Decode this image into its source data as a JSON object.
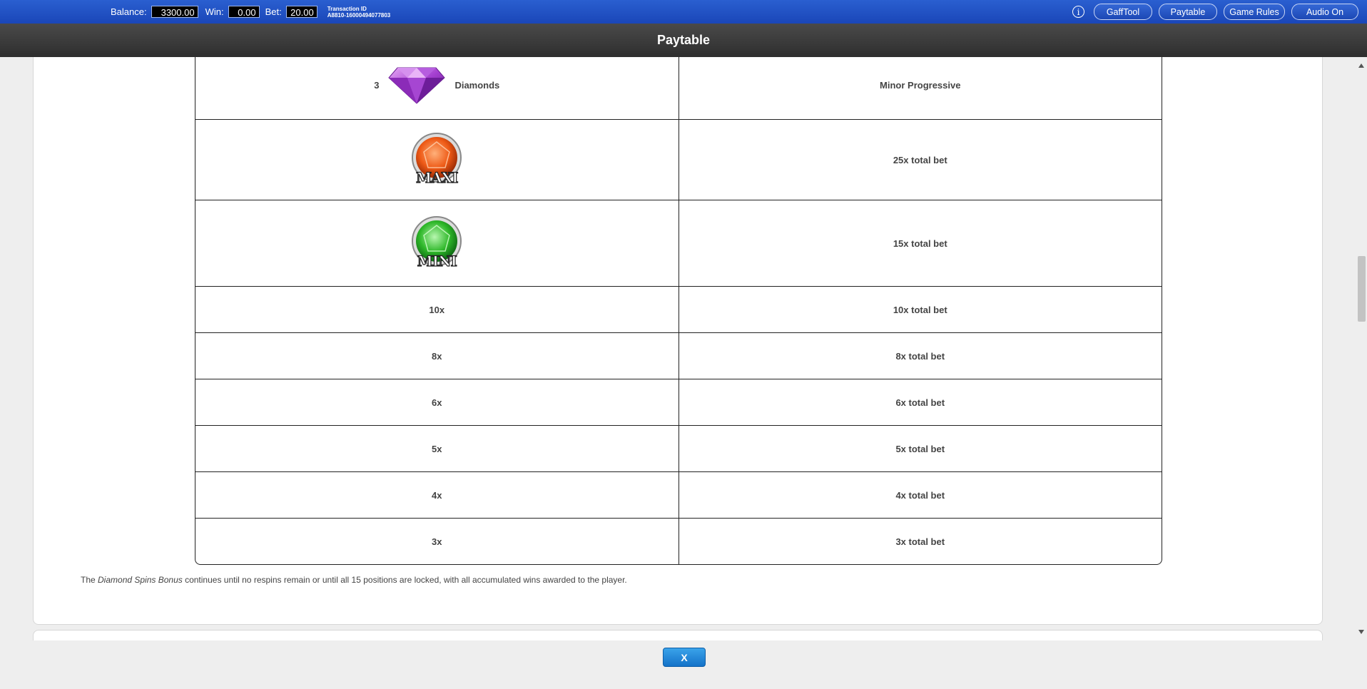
{
  "topbar": {
    "balance_label": "Balance:",
    "balance_value": "3300.00",
    "win_label": "Win:",
    "win_value": "0.00",
    "bet_label": "Bet:",
    "bet_value": "20.00",
    "transaction_label": "Transaction ID",
    "transaction_value": "A8810-16000494077803",
    "info_icon": "info-icon",
    "buttons": {
      "gafftool": "GaffTool",
      "paytable": "Paytable",
      "game_rules": "Game Rules",
      "audio": "Audio On"
    }
  },
  "title": "Paytable",
  "paytable": {
    "diamond_row": {
      "count": "3",
      "symbol_name": "Diamonds",
      "award": "Minor Progressive",
      "icon": "purple-diamond-icon"
    },
    "maxi_row": {
      "icon_text": "MAXI",
      "award": "25x total bet",
      "icon": "orange-gem-maxi-icon"
    },
    "mini_row": {
      "icon_text": "MINI",
      "award": "15x total bet",
      "icon": "green-gem-mini-icon"
    },
    "rows": [
      {
        "symbol": "10x",
        "award": "10x total bet"
      },
      {
        "symbol": "8x",
        "award": "8x total bet"
      },
      {
        "symbol": "6x",
        "award": "6x total bet"
      },
      {
        "symbol": "5x",
        "award": "5x total bet"
      },
      {
        "symbol": "4x",
        "award": "4x total bet"
      },
      {
        "symbol": "3x",
        "award": "3x total bet"
      }
    ]
  },
  "description": {
    "prefix": "The ",
    "emphasis": "Diamond Spins Bonus",
    "suffix": " continues until no respins remain or until all 15 positions are locked, with all accumulated wins awarded to the player."
  },
  "close_label": "X",
  "colors": {
    "topbar": "#1f4fc2",
    "titlebar": "#3a3a3a",
    "close_button": "#2a8ee0"
  }
}
